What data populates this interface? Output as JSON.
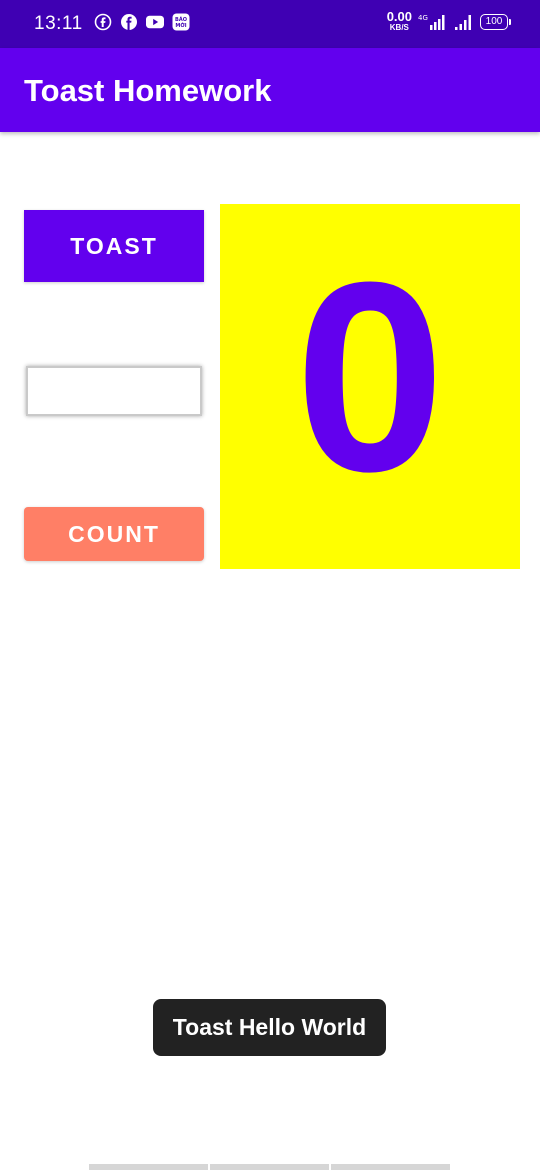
{
  "status_bar": {
    "time": "13:11",
    "left_icons": [
      "facebook-outline-icon",
      "facebook-icon",
      "youtube-icon",
      "baomoi-icon"
    ],
    "baomoi_text": "BÁO MỚI",
    "netspeed_value": "0.00",
    "netspeed_unit": "KB/S",
    "network_label": "4G",
    "battery_level": "100"
  },
  "app_bar": {
    "title": "Toast Homework"
  },
  "main": {
    "toast_button_label": "TOAST",
    "text_field_value": "",
    "count_button_label": "COUNT",
    "count_value": "0"
  },
  "toast": {
    "message": "Toast Hello World"
  },
  "colors": {
    "status_bar": "#3f00b3",
    "primary": "#6200ee",
    "count_button": "#ff7f66",
    "count_panel": "#ffff00",
    "toast_bg": "#222222"
  }
}
